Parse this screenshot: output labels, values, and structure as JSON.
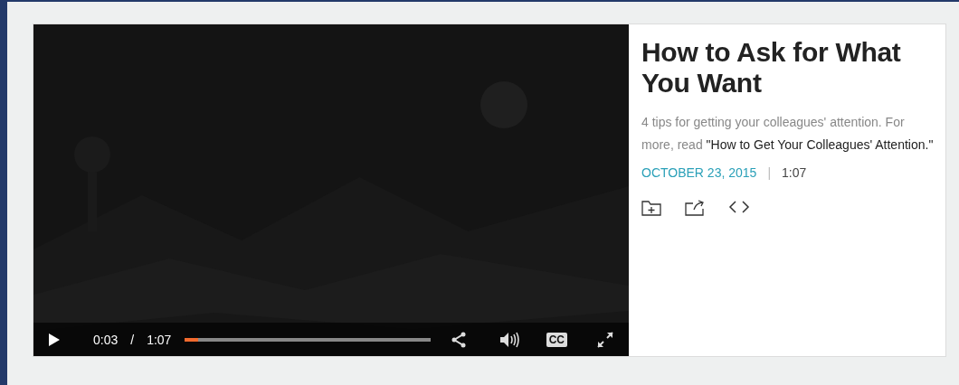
{
  "video": {
    "controls": {
      "playing": false,
      "current_time": "0:03",
      "time_separator": "/",
      "duration": "1:07",
      "progress": {
        "level": 0.055
      },
      "captions_label": "CC"
    }
  },
  "details": {
    "title": "How to Ask for What You Want",
    "description": "4 tips for getting your colleagues' attention. For more, read ",
    "link": "\"How to Get Your Colleagues' Attention.\"",
    "date": "OCTOBER 23, 2015",
    "meta_separator": "|",
    "duration": "1:07"
  }
}
